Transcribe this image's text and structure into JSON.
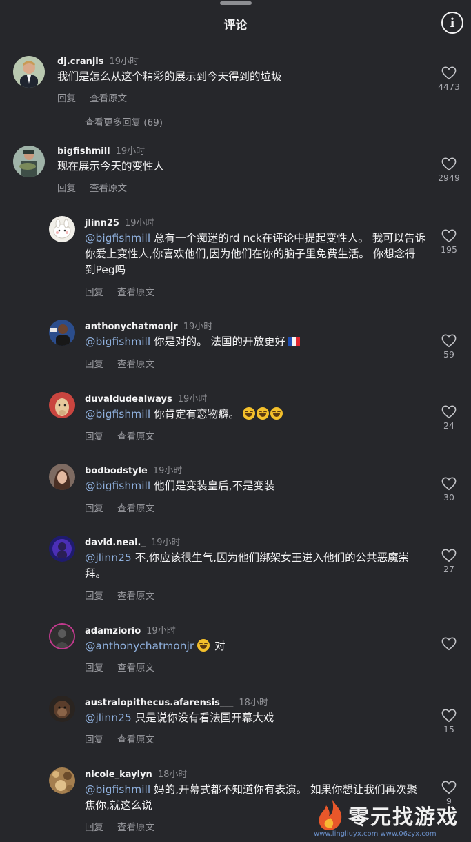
{
  "header": {
    "title": "评论",
    "info_icon": "info-circle-icon"
  },
  "colors": {
    "background": "#26272b",
    "mention": "#8fb0dd",
    "muted": "#9a9ba0"
  },
  "comments": [
    {
      "user": "dj.cranjis",
      "time": "19小时",
      "text": "我们是怎么从这个精彩的展示到今天得到的垃圾",
      "reply": "回复",
      "translate": "查看原文",
      "likes": "4473",
      "more": "查看更多回复 (69)"
    },
    {
      "user": "bigfishmill",
      "time": "19小时",
      "text": "现在展示今天的变性人",
      "reply": "回复",
      "translate": "查看原文",
      "likes": "2949"
    }
  ],
  "replies": [
    {
      "user": "jlinn25",
      "time": "19小时",
      "mention": "@bigfishmill",
      "text": " 总有一个痴迷的rd nck在评论中提起变性人。 我可以告诉你爱上变性人,你喜欢他们,因为他们在你的脑子里免费生活。 你想念得到Peg吗",
      "reply": "回复",
      "translate": "查看原文",
      "likes": "195"
    },
    {
      "user": "anthonychatmonjr",
      "time": "19小时",
      "mention": "@bigfishmill",
      "text": " 你是对的。 法国的开放更好",
      "reply": "回复",
      "translate": "查看原文",
      "likes": "59"
    },
    {
      "user": "duvaldudealways",
      "time": "19小时",
      "mention": "@bigfishmill",
      "text": " 你肯定有恋物癖。 ",
      "reply": "回复",
      "translate": "查看原文",
      "likes": "24"
    },
    {
      "user": "bodbodstyle",
      "time": "19小时",
      "mention": "@bigfishmill",
      "text": " 他们是变装皇后,不是变装",
      "reply": "回复",
      "translate": "查看原文",
      "likes": "30"
    },
    {
      "user": "david.neal._",
      "time": "19小时",
      "mention": "@jlinn25",
      "text": " 不,你应该很生气,因为他们绑架女王进入他们的公共恶魔崇拜。",
      "reply": "回复",
      "translate": "查看原文",
      "likes": "27"
    },
    {
      "user": "adamziorio",
      "time": "19小时",
      "mention": "@anthonychatmonjr",
      "text": " 对",
      "reply": "回复",
      "translate": "查看原文",
      "likes": ""
    },
    {
      "user": "australopithecus.afarensis___",
      "time": "18小时",
      "mention": "@jlinn25",
      "text": " 只是说你没有看法国开幕大戏",
      "reply": "回复",
      "translate": "查看原文",
      "likes": "15"
    },
    {
      "user": "nicole_kaylyn",
      "time": "18小时",
      "mention": "@bigfishmill",
      "text": " 妈的,开幕式都不知道你有表演。 如果你想让我们再次聚焦你,就这么说",
      "reply": "回复",
      "translate": "查看原文",
      "likes": "9"
    }
  ],
  "watermark": {
    "text": "零元找游戏",
    "url": "www.lingliuyx.com  www.06zyx.com"
  }
}
